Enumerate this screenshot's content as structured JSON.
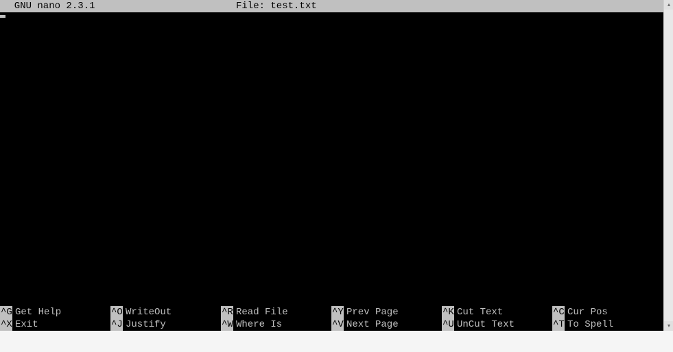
{
  "titlebar": {
    "app_name": "  GNU nano 2.3.1",
    "file_label": "File: test.txt"
  },
  "editor": {
    "content": ""
  },
  "shortcuts": {
    "row1": [
      {
        "key": "^G",
        "label": "Get Help"
      },
      {
        "key": "^O",
        "label": "WriteOut"
      },
      {
        "key": "^R",
        "label": "Read File"
      },
      {
        "key": "^Y",
        "label": "Prev Page"
      },
      {
        "key": "^K",
        "label": "Cut Text"
      },
      {
        "key": "^C",
        "label": "Cur Pos"
      }
    ],
    "row2": [
      {
        "key": "^X",
        "label": "Exit"
      },
      {
        "key": "^J",
        "label": "Justify"
      },
      {
        "key": "^W",
        "label": "Where Is"
      },
      {
        "key": "^V",
        "label": "Next Page"
      },
      {
        "key": "^U",
        "label": "UnCut Text"
      },
      {
        "key": "^T",
        "label": "To Spell"
      }
    ]
  },
  "scroll": {
    "up": "▴",
    "down": "▾"
  }
}
